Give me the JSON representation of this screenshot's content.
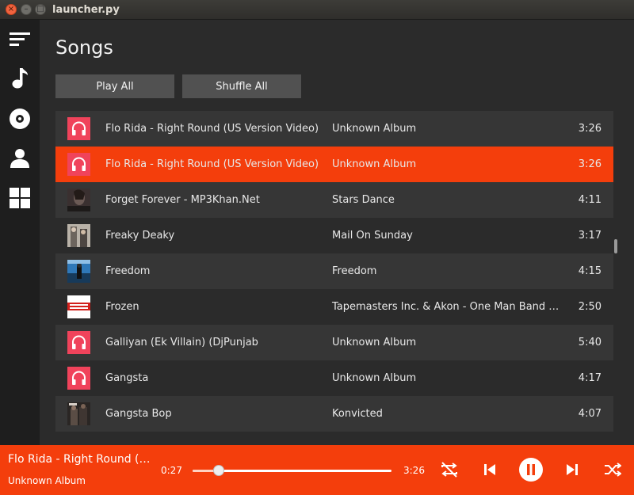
{
  "window": {
    "title": "launcher.py"
  },
  "sidebar": {
    "items": [
      {
        "icon": "sort-icon"
      },
      {
        "icon": "music-note-icon"
      },
      {
        "icon": "disc-icon"
      },
      {
        "icon": "person-icon"
      },
      {
        "icon": "grid-icon"
      }
    ]
  },
  "page": {
    "title": "Songs"
  },
  "actions": {
    "play_all": "Play All",
    "shuffle_all": "Shuffle All"
  },
  "songs": [
    {
      "title": "Flo Rida - Right Round (US Version Video)",
      "album": "Unknown Album",
      "duration": "3:26",
      "art": "headphones"
    },
    {
      "title": "Flo Rida - Right Round (US Version Video)",
      "album": "Unknown Album",
      "duration": "3:26",
      "art": "headphones",
      "selected": true
    },
    {
      "title": "Forget Forever - MP3Khan.Net",
      "album": "Stars Dance",
      "duration": "4:11",
      "art": "photo"
    },
    {
      "title": "Freaky Deaky",
      "album": "Mail On Sunday",
      "duration": "3:17",
      "art": "photo"
    },
    {
      "title": "Freedom",
      "album": "Freedom",
      "duration": "4:15",
      "art": "photo"
    },
    {
      "title": "Frozen",
      "album": "Tapemasters Inc. & Akon - One Man Band …",
      "duration": "2:50",
      "art": "photo"
    },
    {
      "title": "Galliyan (Ek Villain) (DjPunjab",
      "album": "Unknown Album",
      "duration": "5:40",
      "art": "headphones"
    },
    {
      "title": "Gangsta",
      "album": "Unknown Album",
      "duration": "4:17",
      "art": "headphones"
    },
    {
      "title": "Gangsta Bop",
      "album": "Konvicted",
      "duration": "4:07",
      "art": "photo"
    }
  ],
  "player": {
    "title": "Flo Rida - Right Round (…",
    "album": "Unknown Album",
    "current_time": "0:27",
    "total_time": "3:26",
    "progress": 0.13
  },
  "colors": {
    "accent": "#f43e0c",
    "art_pink": "#f0435b",
    "sidebar": "#1e1e1e"
  }
}
